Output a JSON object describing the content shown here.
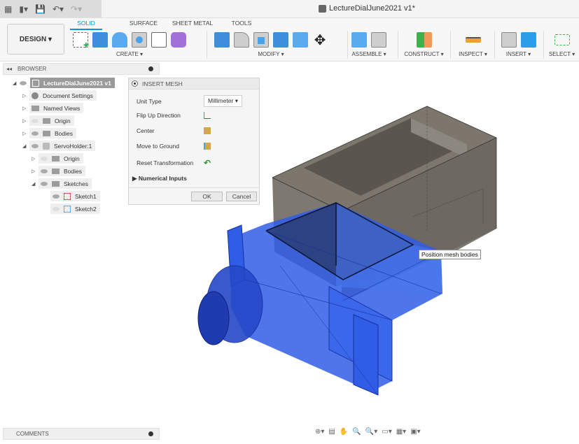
{
  "app": {
    "document_title": "LectureDialJune2021 v1*"
  },
  "quick_access": {
    "grid_icon": "apps-grid-icon",
    "file_icon": "file-icon",
    "save_icon": "save-icon",
    "undo_icon": "undo-icon",
    "redo_icon": "redo-icon"
  },
  "ribbon": {
    "workspace": "DESIGN ▾",
    "tabs": [
      {
        "label": "SOLID",
        "active": true
      },
      {
        "label": "SURFACE",
        "active": false
      },
      {
        "label": "SHEET METAL",
        "active": false
      },
      {
        "label": "TOOLS",
        "active": false
      }
    ],
    "groups": [
      {
        "label": "CREATE ▾"
      },
      {
        "label": "MODIFY ▾"
      },
      {
        "label": "ASSEMBLE ▾"
      },
      {
        "label": "CONSTRUCT ▾"
      },
      {
        "label": "INSPECT ▾"
      },
      {
        "label": "INSERT ▾"
      },
      {
        "label": "SELECT ▾"
      }
    ]
  },
  "browser": {
    "title": "BROWSER",
    "items": [
      {
        "label": "LectureDialJune2021 v1",
        "expander": "◢"
      },
      {
        "label": "Document Settings",
        "expander": "▷"
      },
      {
        "label": "Named Views",
        "expander": "▷"
      },
      {
        "label": "Origin",
        "expander": "▷"
      },
      {
        "label": "Bodies",
        "expander": "▷"
      },
      {
        "label": "ServoHolder:1",
        "expander": "◢"
      },
      {
        "label": "Origin",
        "expander": "▷"
      },
      {
        "label": "Bodies",
        "expander": "▷"
      },
      {
        "label": "Sketches",
        "expander": "◢"
      },
      {
        "label": "Sketch1",
        "expander": ""
      },
      {
        "label": "Sketch2",
        "expander": ""
      }
    ]
  },
  "insert_mesh": {
    "title": "INSERT MESH",
    "unit_type_label": "Unit Type",
    "unit_type_value": "Millimeter ▾",
    "flip_label": "Flip Up Direction",
    "center_label": "Center",
    "ground_label": "Move to Ground",
    "reset_label": "Reset Transformation",
    "numerical_label": "▶ Numerical Inputs",
    "ok_label": "OK",
    "cancel_label": "Cancel"
  },
  "viewport": {
    "tooltip": "Position mesh bodies"
  },
  "comments": {
    "title": "COMMENTS"
  },
  "navbar": {
    "items": [
      "⊕▾",
      "▤",
      "✋",
      "🔍",
      "🔍▾",
      "▭▾",
      "▦▾",
      "▣▾"
    ]
  }
}
